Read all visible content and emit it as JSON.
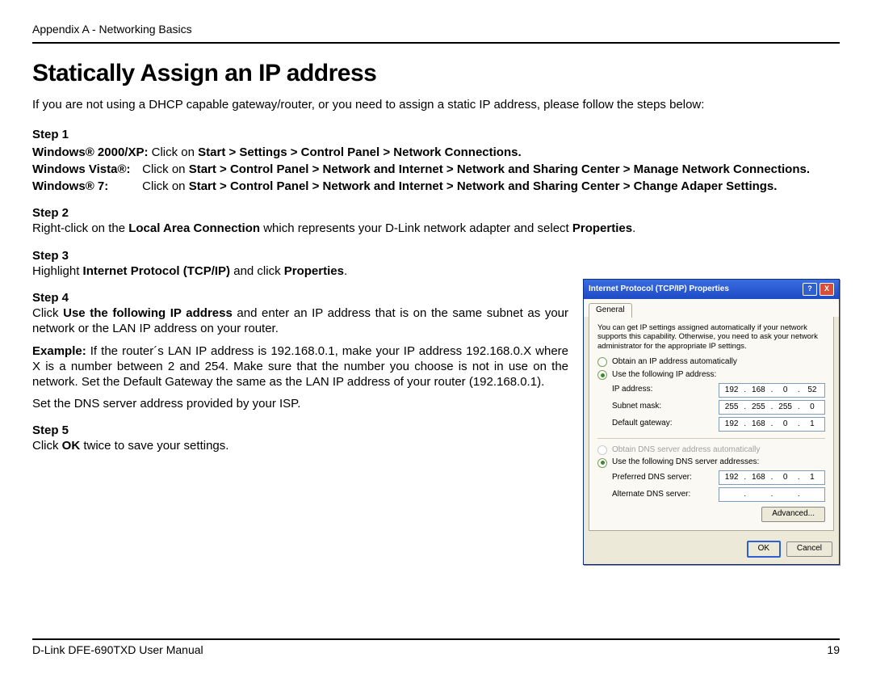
{
  "header": "Appendix A - Networking Basics",
  "title": "Statically Assign an IP address",
  "intro": "If you are not using a DHCP capable gateway/router, or you need to assign a static IP address, please follow the steps below:",
  "step1": "Step 1",
  "win2000_label": "Windows® 2000/XP:",
  "win2000_pre": "  Click on ",
  "win2000_bold": "Start > Settings > Control Panel > Network Connections.",
  "vista_label": "Windows Vista®:",
  "vista_pre": "   Click on ",
  "vista_bold": "Start > Control Panel > Network and Internet > Network and Sharing Center > Manage Network Connections.",
  "win7_label": "Windows® 7:",
  "win7_pre": "  Click on ",
  "win7_bold": "Start > Control Panel > Network and Internet > Network and Sharing Center > Change Adaper Settings.",
  "step2": "Step 2",
  "step2_pre": "Right-click on the ",
  "step2_b1": "Local Area Connection",
  "step2_mid": " which represents your D-Link network adapter and select ",
  "step2_b2": "Properties",
  "step3": "Step 3",
  "step3_pre": "Highlight ",
  "step3_b1": "Internet Protocol (TCP/IP)",
  "step3_mid": " and click ",
  "step3_b2": "Properties",
  "step4": "Step 4",
  "step4_pre": "Click ",
  "step4_b1": "Use the following IP address",
  "step4_post": " and enter an IP address that is on the same subnet as your network or the LAN IP address on your router.",
  "example_b": "Example:",
  "example_text": " If the router´s LAN IP address is 192.168.0.1, make your IP address 192.168.0.X where X is a number between 2 and 254. Make sure that the number you choose is not in use on the network. Set the Default Gateway the same as the LAN IP address of your router (192.168.0.1).",
  "dns_line": "Set the DNS server address provided by your ISP.",
  "step5": "Step 5",
  "step5_pre": "Click ",
  "step5_b": "OK",
  "step5_post": " twice to save your settings.",
  "footer_left": "D-Link DFE-690TXD User Manual",
  "footer_right": "19",
  "dlg": {
    "title": "Internet Protocol (TCP/IP) Properties",
    "tab": "General",
    "desc": "You can get IP settings assigned automatically if your network supports this capability. Otherwise, you need to ask your network administrator for the appropriate IP settings.",
    "r1": "Obtain an IP address automatically",
    "r2": "Use the following IP address:",
    "f_ip": "IP address:",
    "f_mask": "Subnet mask:",
    "f_gw": "Default gateway:",
    "r3": "Obtain DNS server address automatically",
    "r4": "Use the following DNS server addresses:",
    "f_pdns": "Preferred DNS server:",
    "f_adns": "Alternate DNS server:",
    "adv": "Advanced...",
    "ok": "OK",
    "cancel": "Cancel",
    "ip": [
      "192",
      "168",
      "0",
      "52"
    ],
    "mask": [
      "255",
      "255",
      "255",
      "0"
    ],
    "gw": [
      "192",
      "168",
      "0",
      "1"
    ],
    "pdns": [
      "192",
      "168",
      "0",
      "1"
    ]
  }
}
